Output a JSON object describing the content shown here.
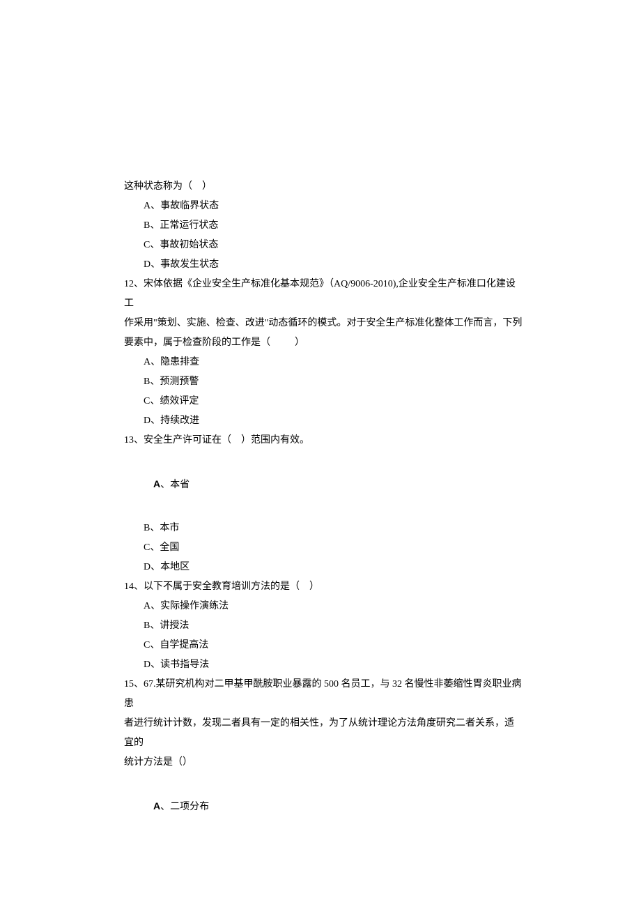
{
  "lines": {
    "l0": "这种状态称为（    ）",
    "l1": "A、事故临界状态",
    "l2": "B、正常运行状态",
    "l3": "C、事故初始状态",
    "l4": "D、事故发生状态",
    "q12a": "12、宋体依据《企业安全生产标准化基本规范》（AQ/9006-2010),企业安全生产标准口化建设工",
    "q12b": "作采用\"策划、实施、检查、改进\"动态循环的模式。对于安全生产标准化整体工作而言，下列",
    "q12c": "要素中，属于检查阶段的工作是（          ）",
    "l5": "A、隐患排查",
    "l6": "B、预测预警",
    "l7": "C、绩效评定",
    "l8": "D、持续改进",
    "q13": "13、安全生产许可证在（    ）范围内有效。",
    "q13a_prefix": "A",
    "q13a_text": "、本省",
    "l9": "B、本市",
    "l10": "C、全国",
    "l11": "D、本地区",
    "q14": "14、以下不属于安全教育培训方法的是（    ）",
    "l12": "A、实际操作演练法",
    "l13": "B、讲授法",
    "l14": "C、自学提高法",
    "l15": "D、读书指导法",
    "q15a": "15、67.某研究机构对二甲基甲酰胺职业暴露的 500 名员工，与 32 名慢性非萎缩性胃炎职业病患",
    "q15b": "者进行统计计数，发现二者具有一定的相关性，为了从统计理论方法角度研究二者关系，适宜的",
    "q15c": "统计方法是（）",
    "q15d_prefix": "A",
    "q15d_text": "、二项分布"
  }
}
